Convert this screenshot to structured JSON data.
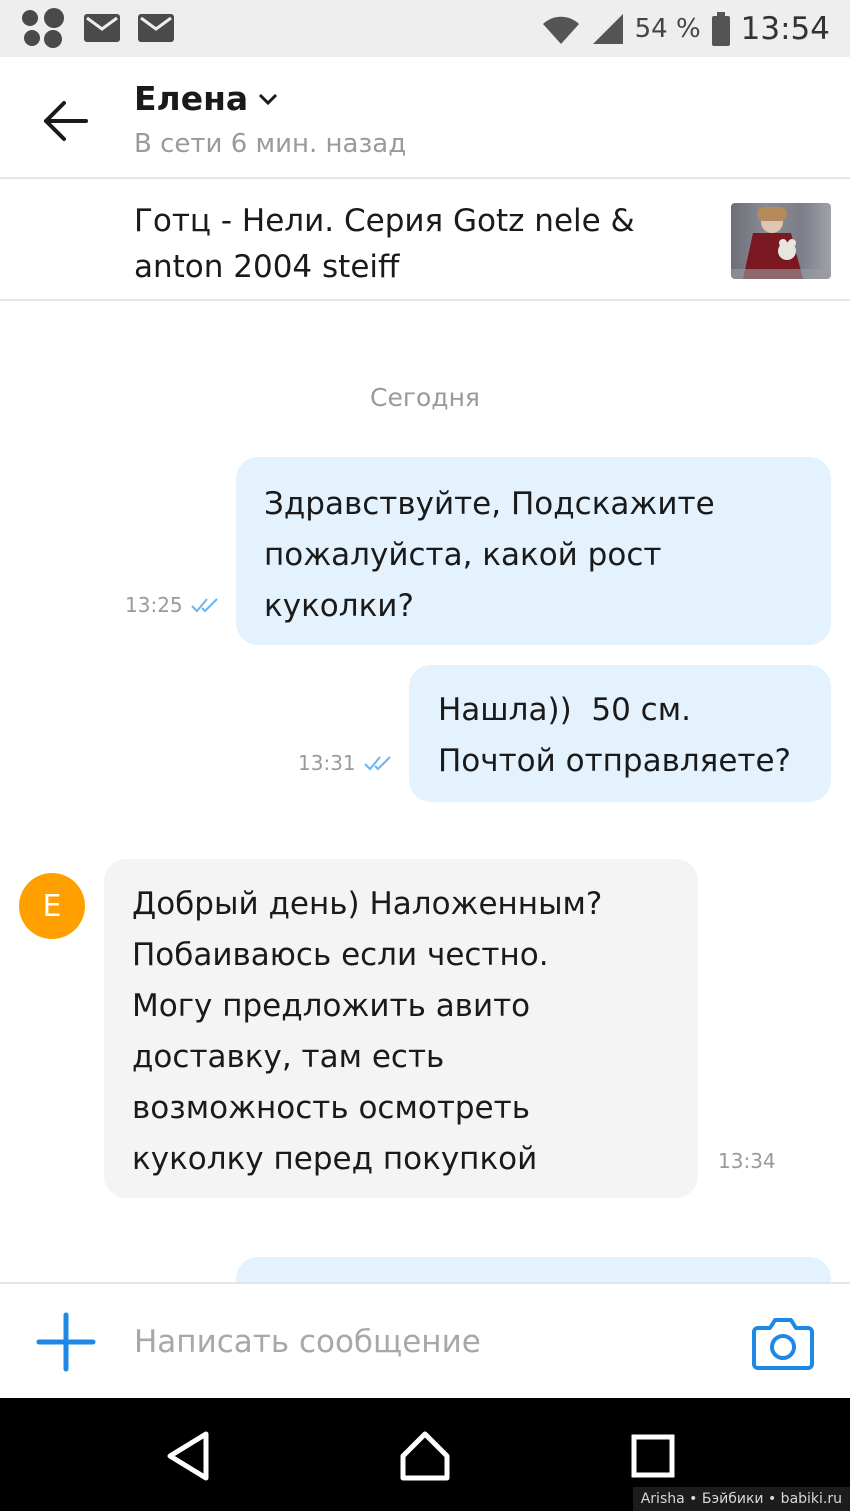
{
  "status_bar": {
    "battery": "54 %",
    "time": "13:54",
    "icons": [
      "notification-dots-icon",
      "mail-icon",
      "mail-icon",
      "wifi-icon",
      "signal-icon",
      "battery-icon"
    ]
  },
  "header": {
    "contact_name": "Елена",
    "contact_status": "В сети 6 мин. назад"
  },
  "listing": {
    "title": "Готц - Нели. Серия Gotz nele & anton 2004 steiff"
  },
  "chat": {
    "date_separator": "Сегодня",
    "messages": [
      {
        "direction": "outgoing",
        "lines": [
          "Здравствуйте, Подскажите",
          "пожалуйста, какой рост",
          "куколки?"
        ],
        "time": "13:25",
        "read": true
      },
      {
        "direction": "outgoing",
        "lines": [
          "Нашла))  50 см.",
          "Почтой отправляете?"
        ],
        "time": "13:31",
        "read": true
      },
      {
        "direction": "incoming",
        "avatar_letter": "Е",
        "lines": [
          "Добрый день) Наложенным?",
          "Побаиваюсь если честно.",
          "Могу предложить авито",
          "доставку, там есть",
          "возможность осмотреть",
          "куколку перед покупкой"
        ],
        "time": "13:34"
      }
    ]
  },
  "input_bar": {
    "placeholder": "Написать сообщение"
  },
  "watermark": "Arisha • Бэйбики • babiki.ru",
  "colors": {
    "accent": "#1e88e5",
    "outgoing_bubble": "#e3f2fd",
    "incoming_bubble": "#f4f4f4",
    "avatar": "#ffa000",
    "read_check": "#64b5f6"
  }
}
